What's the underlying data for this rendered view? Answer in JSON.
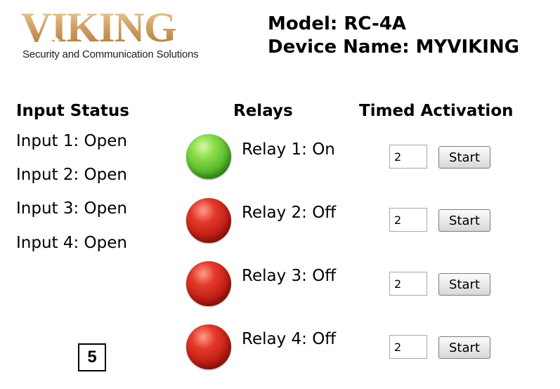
{
  "logo": {
    "wordmark": "VIKING",
    "tagline": "Security and Communication Solutions"
  },
  "header": {
    "model": "Model: RC-4A",
    "device_name": "Device Name: MYVIKING"
  },
  "columns": {
    "input_status": "Input Status",
    "relays": "Relays",
    "timed_activation": "Timed Activation"
  },
  "inputs": [
    {
      "label": "Input 1: Open"
    },
    {
      "label": "Input 2: Open"
    },
    {
      "label": "Input 3: Open"
    },
    {
      "label": "Input 4: Open"
    }
  ],
  "relays": [
    {
      "label": "Relay 1: On",
      "state": "on",
      "led_color": "#4cb324",
      "duration": "2",
      "button": "Start"
    },
    {
      "label": "Relay 2: Off",
      "state": "off",
      "led_color": "#bb1a12",
      "duration": "2",
      "button": "Start"
    },
    {
      "label": "Relay 3: Off",
      "state": "off",
      "led_color": "#bb1a12",
      "duration": "2",
      "button": "Start"
    },
    {
      "label": "Relay 4: Off",
      "state": "off",
      "led_color": "#bb1a12",
      "duration": "2",
      "button": "Start"
    }
  ],
  "badge": "5"
}
